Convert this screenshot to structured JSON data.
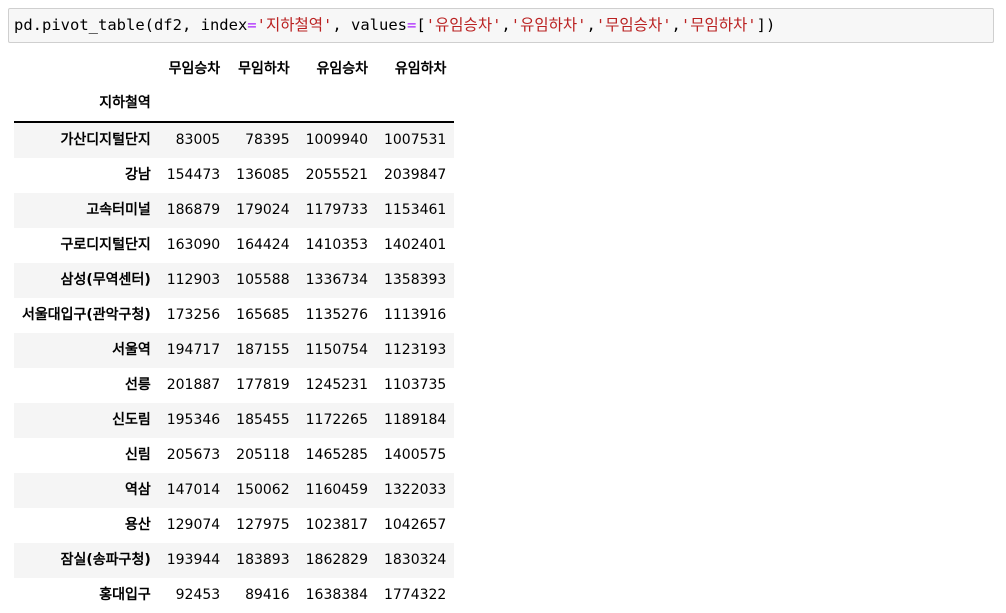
{
  "code_cell": {
    "tokens": [
      {
        "t": "pd.pivot_table(df2, index",
        "c": "plain"
      },
      {
        "t": "=",
        "c": "op"
      },
      {
        "t": "'지하철역'",
        "c": "str"
      },
      {
        "t": ", values",
        "c": "plain"
      },
      {
        "t": "=",
        "c": "op"
      },
      {
        "t": "[",
        "c": "plain"
      },
      {
        "t": "'유임승차'",
        "c": "str"
      },
      {
        "t": ",",
        "c": "plain"
      },
      {
        "t": "'유임하차'",
        "c": "str"
      },
      {
        "t": ",",
        "c": "plain"
      },
      {
        "t": "'무임승차'",
        "c": "str"
      },
      {
        "t": ",",
        "c": "plain"
      },
      {
        "t": "'무임하차'",
        "c": "str"
      },
      {
        "t": "])",
        "c": "plain"
      }
    ]
  },
  "table": {
    "index_name": "지하철역",
    "columns": [
      "무임승차",
      "무임하차",
      "유임승차",
      "유임하차"
    ],
    "rows": [
      {
        "station": "가산디지털단지",
        "values": [
          "83005",
          "78395",
          "1009940",
          "1007531"
        ]
      },
      {
        "station": "강남",
        "values": [
          "154473",
          "136085",
          "2055521",
          "2039847"
        ]
      },
      {
        "station": "고속터미널",
        "values": [
          "186879",
          "179024",
          "1179733",
          "1153461"
        ]
      },
      {
        "station": "구로디지털단지",
        "values": [
          "163090",
          "164424",
          "1410353",
          "1402401"
        ]
      },
      {
        "station": "삼성(무역센터)",
        "values": [
          "112903",
          "105588",
          "1336734",
          "1358393"
        ]
      },
      {
        "station": "서울대입구(관악구청)",
        "values": [
          "173256",
          "165685",
          "1135276",
          "1113916"
        ]
      },
      {
        "station": "서울역",
        "values": [
          "194717",
          "187155",
          "1150754",
          "1123193"
        ]
      },
      {
        "station": "선릉",
        "values": [
          "201887",
          "177819",
          "1245231",
          "1103735"
        ]
      },
      {
        "station": "신도림",
        "values": [
          "195346",
          "185455",
          "1172265",
          "1189184"
        ]
      },
      {
        "station": "신림",
        "values": [
          "205673",
          "205118",
          "1465285",
          "1400575"
        ]
      },
      {
        "station": "역삼",
        "values": [
          "147014",
          "150062",
          "1160459",
          "1322033"
        ]
      },
      {
        "station": "용산",
        "values": [
          "129074",
          "127975",
          "1023817",
          "1042657"
        ]
      },
      {
        "station": "잠실(송파구청)",
        "values": [
          "193944",
          "183893",
          "1862829",
          "1830324"
        ]
      },
      {
        "station": "홍대입구",
        "values": [
          "92453",
          "89416",
          "1638384",
          "1774322"
        ]
      }
    ]
  }
}
